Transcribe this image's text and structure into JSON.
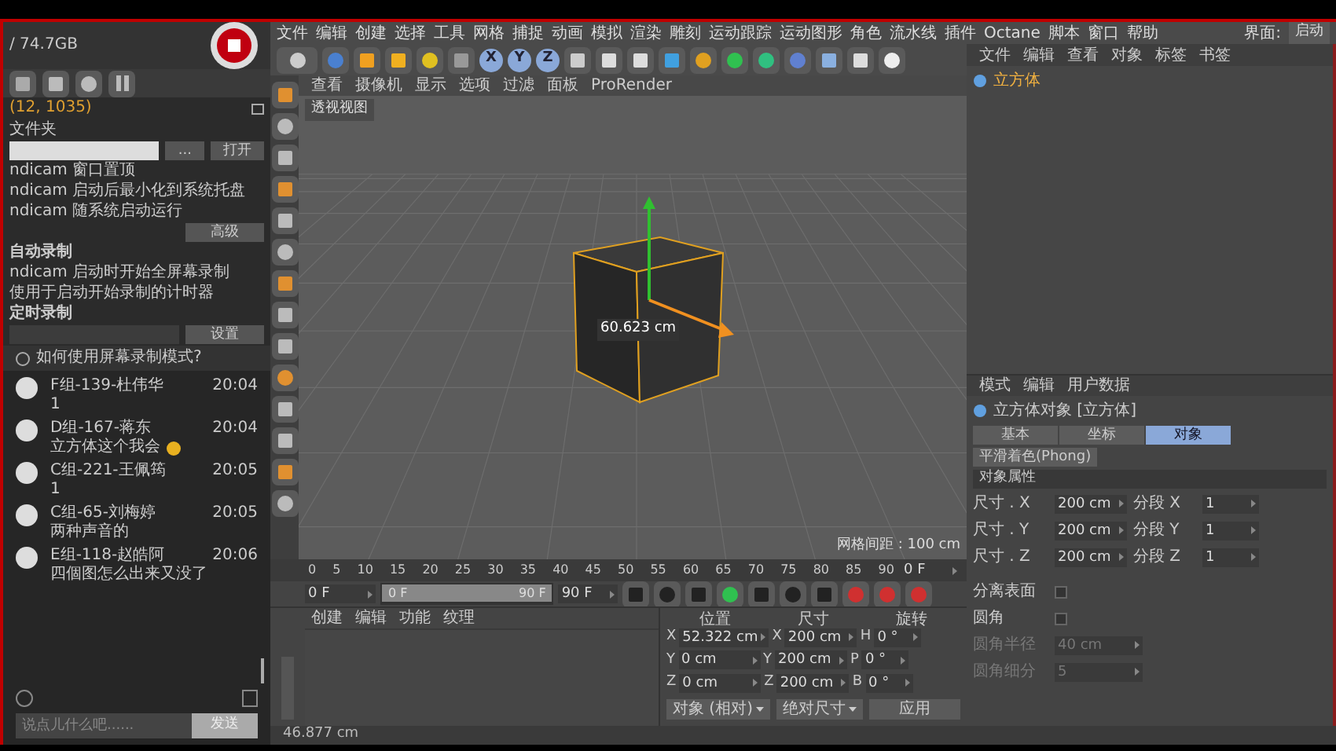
{
  "recorder": {
    "disk": "/ 74.7GB",
    "coords": "(12, 1035)",
    "folder_label": "文件夹",
    "folder_buttons": [
      "...",
      "打开"
    ],
    "options": [
      "ndicam 窗口置顶",
      "ndicam 启动后最小化到系统托盘",
      "ndicam 随系统启动运行"
    ],
    "options_button": "高级",
    "auto_title": "自动录制",
    "auto_options": [
      "ndicam 启动时开始全屏幕录制",
      "使用于启动开始录制的计时器"
    ],
    "timer_title": "定时录制",
    "timer_button": "设置",
    "help": "如何使用屏幕录制模式?"
  },
  "chat": {
    "messages": [
      {
        "name": "F组-139-杜伟华",
        "time": "20:04",
        "text": "1",
        "sticker": false
      },
      {
        "name": "D组-167-蒋东",
        "time": "20:04",
        "text": "立方体这个我会",
        "sticker": true
      },
      {
        "name": "C组-221-王佩筠",
        "time": "20:05",
        "text": "1",
        "sticker": false
      },
      {
        "name": "C组-65-刘梅婷",
        "time": "20:05",
        "text": "两种声音的",
        "sticker": false
      },
      {
        "name": "E组-118-赵皓阿",
        "time": "20:06",
        "text": "四個图怎么出来又没了",
        "sticker": false
      }
    ],
    "placeholder": "说点儿什么吧......",
    "send": "发送"
  },
  "menu": [
    "文件",
    "编辑",
    "创建",
    "选择",
    "工具",
    "网格",
    "捕捉",
    "动画",
    "模拟",
    "渲染",
    "雕刻",
    "运动跟踪",
    "运动图形",
    "角色",
    "流水线",
    "插件",
    "Octane",
    "脚本",
    "窗口",
    "帮助"
  ],
  "layout": {
    "label": "界面:",
    "value": "启动"
  },
  "axis_buttons": [
    "X",
    "Y",
    "Z"
  ],
  "viewport": {
    "menu": [
      "查看",
      "摄像机",
      "显示",
      "选项",
      "过滤",
      "面板",
      "ProRender"
    ],
    "label": "透视视图",
    "measure": "60.623 cm",
    "grid": "网格间距 : 100 cm"
  },
  "timeline": {
    "ticks": [
      "0",
      "5",
      "10",
      "15",
      "20",
      "25",
      "30",
      "35",
      "40",
      "45",
      "50",
      "55",
      "60",
      "65",
      "70",
      "75",
      "80",
      "85",
      "90"
    ],
    "frame": "0 F",
    "start": "0 F",
    "range_start": "0 F",
    "range_end": "90 F",
    "end": "90 F",
    "level": 1
  },
  "material_menu": [
    "创建",
    "编辑",
    "功能",
    "纹理"
  ],
  "coordinates": {
    "headers": [
      "位置",
      "尺寸",
      "旋转"
    ],
    "rows": [
      {
        "pos_axis": "X",
        "pos": "52.322 cm",
        "size_axis": "X",
        "size": "200 cm",
        "rot_axis": "H",
        "rot": "0 °"
      },
      {
        "pos_axis": "Y",
        "pos": "0 cm",
        "size_axis": "Y",
        "size": "200 cm",
        "rot_axis": "P",
        "rot": "0 °"
      },
      {
        "pos_axis": "Z",
        "pos": "0 cm",
        "size_axis": "Z",
        "size": "200 cm",
        "rot_axis": "B",
        "rot": "0 °"
      }
    ],
    "mode": "对象 (相对)",
    "size_mode": "绝对尺寸",
    "apply": "应用"
  },
  "status": "46.877 cm",
  "objects": {
    "menu": [
      "文件",
      "编辑",
      "查看",
      "对象",
      "标签",
      "书签"
    ],
    "items": [
      {
        "name": "立方体",
        "selected": true
      }
    ]
  },
  "attributes": {
    "menu": [
      "模式",
      "编辑",
      "用户数据"
    ],
    "title": "立方体对象 [立方体]",
    "tabs": [
      {
        "label": "基本",
        "selected": false
      },
      {
        "label": "坐标",
        "selected": false
      },
      {
        "label": "对象",
        "selected": true
      }
    ],
    "subtab": "平滑着色(Phong)",
    "section": "对象属性",
    "size_rows": [
      {
        "label": "尺寸 . X",
        "value": "200 cm",
        "seg_label": "分段 X",
        "seg": "1"
      },
      {
        "label": "尺寸 . Y",
        "value": "200 cm",
        "seg_label": "分段 Y",
        "seg": "1"
      },
      {
        "label": "尺寸 . Z",
        "value": "200 cm",
        "seg_label": "分段 Z",
        "seg": "1"
      }
    ],
    "options": [
      {
        "kind": "check",
        "label": "分离表面",
        "checked": false,
        "disabled": false
      },
      {
        "kind": "check",
        "label": "圆角",
        "checked": false,
        "disabled": false
      },
      {
        "kind": "field",
        "label": "圆角半径",
        "value": "40 cm",
        "disabled": true
      },
      {
        "kind": "field",
        "label": "圆角细分",
        "value": "5",
        "disabled": true
      }
    ]
  }
}
